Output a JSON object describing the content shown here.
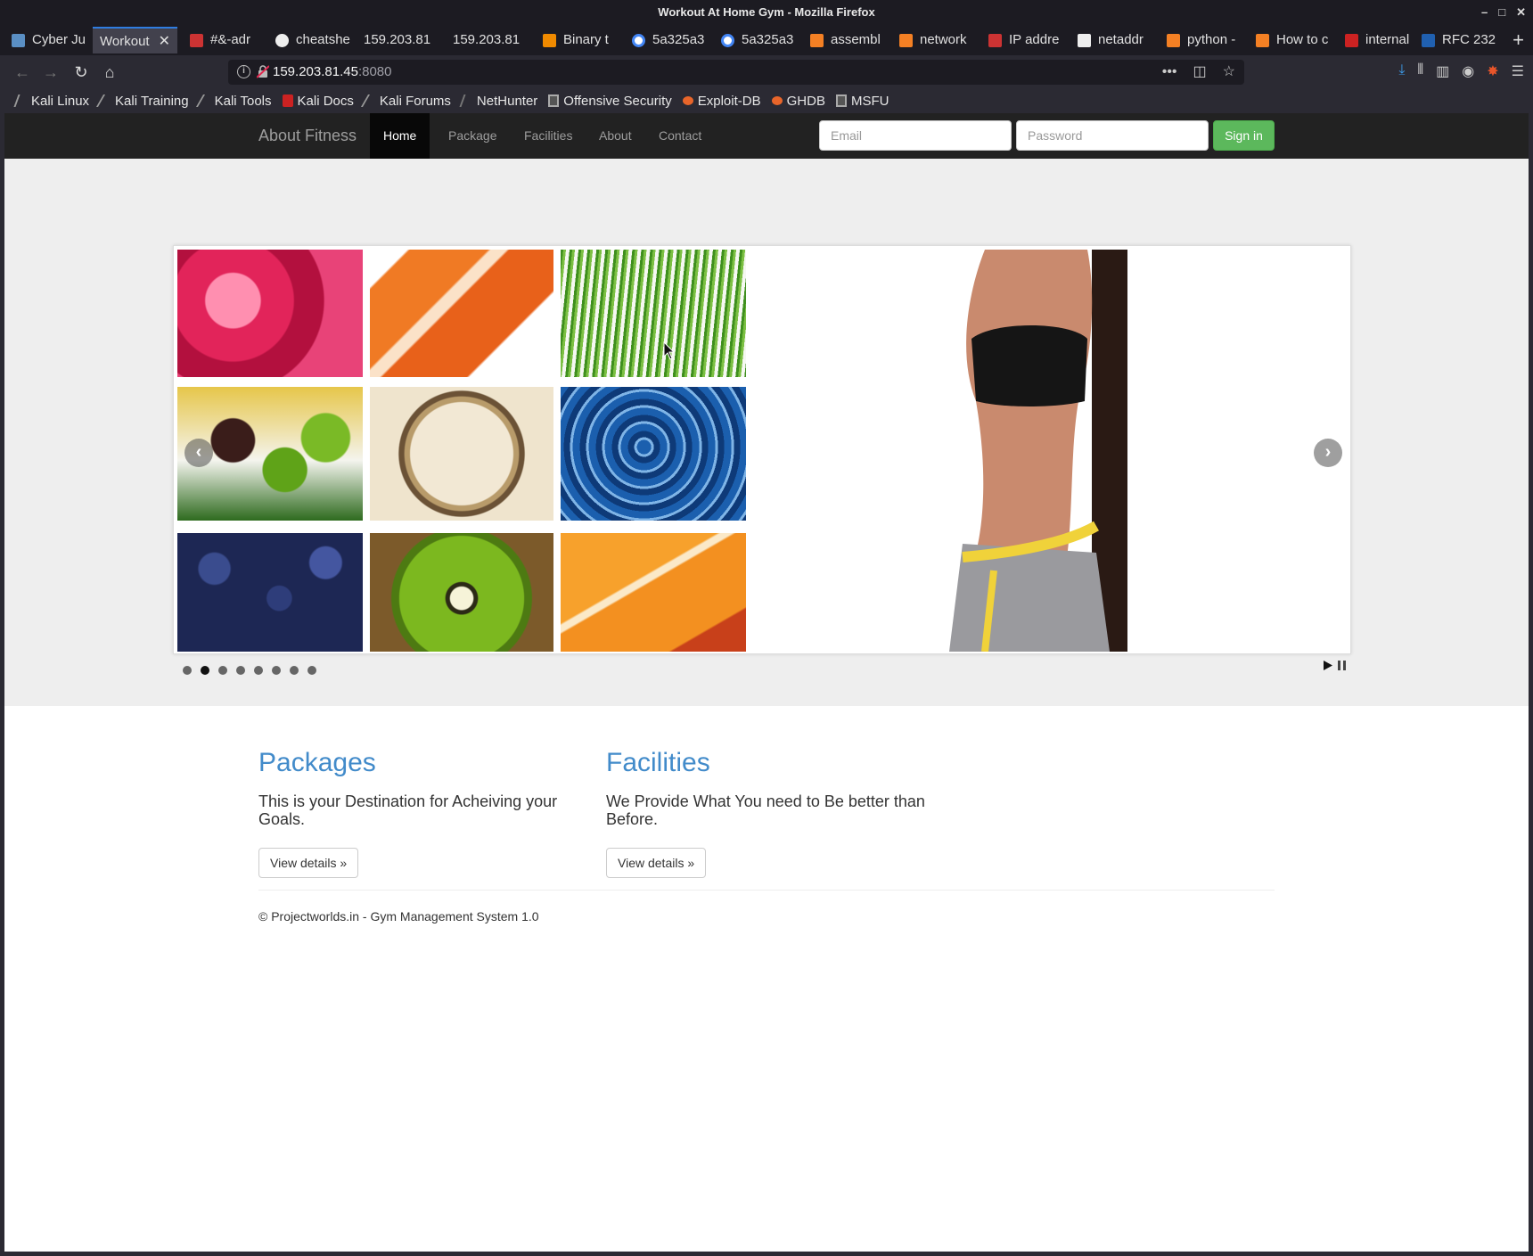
{
  "window": {
    "title": "Workout At Home Gym - Mozilla Firefox"
  },
  "tabs": [
    {
      "label": "Cyber Ju",
      "icon": "site-icon"
    },
    {
      "label": "Workout",
      "icon": "none"
    },
    {
      "label": "#&-adr",
      "icon": "site-icon"
    },
    {
      "label": "cheatshe",
      "icon": "github-icon"
    },
    {
      "label": "159.203.81",
      "icon": "none"
    },
    {
      "label": "159.203.81",
      "icon": "none"
    },
    {
      "label": "Binary t",
      "icon": "r-icon"
    },
    {
      "label": "5a325a3",
      "icon": "google-icon"
    },
    {
      "label": "5a325a3",
      "icon": "google-icon"
    },
    {
      "label": "assembl",
      "icon": "stackoverflow-icon"
    },
    {
      "label": "network",
      "icon": "stackoverflow-icon"
    },
    {
      "label": "IP addre",
      "icon": "site-icon"
    },
    {
      "label": "netaddr",
      "icon": "site-icon"
    },
    {
      "label": "python -",
      "icon": "stackoverflow-icon"
    },
    {
      "label": "How to c",
      "icon": "stackoverflow-icon"
    },
    {
      "label": "internal",
      "icon": "site-icon"
    },
    {
      "label": "RFC 232",
      "icon": "site-icon"
    }
  ],
  "urlbar": {
    "host": "159.203.81.45",
    "port": ":8080"
  },
  "bookmarks": [
    "Kali Linux",
    "Kali Training",
    "Kali Tools",
    "Kali Docs",
    "Kali Forums",
    "NetHunter",
    "Offensive Security",
    "Exploit-DB",
    "GHDB",
    "MSFU"
  ],
  "site": {
    "brand": "About Fitness",
    "nav": [
      "Home",
      "Package",
      "Facilities",
      "About",
      "Contact"
    ],
    "email_placeholder": "Email",
    "password_placeholder": "Password",
    "signin_label": "Sign in",
    "carousel": {
      "slide_count": 8,
      "active_index": 1
    },
    "packages": {
      "heading": "Packages",
      "text": "This is your Destination for Acheiving your Goals.",
      "button": "View details »"
    },
    "facilities": {
      "heading": "Facilities",
      "text": "We Provide What You need to Be better than Before.",
      "button": "View details »"
    },
    "footer": "© Projectworlds.in - Gym Management System 1.0"
  },
  "colors": {
    "accent": "#428bca",
    "success": "#5cb85c",
    "navbar": "#222222"
  }
}
